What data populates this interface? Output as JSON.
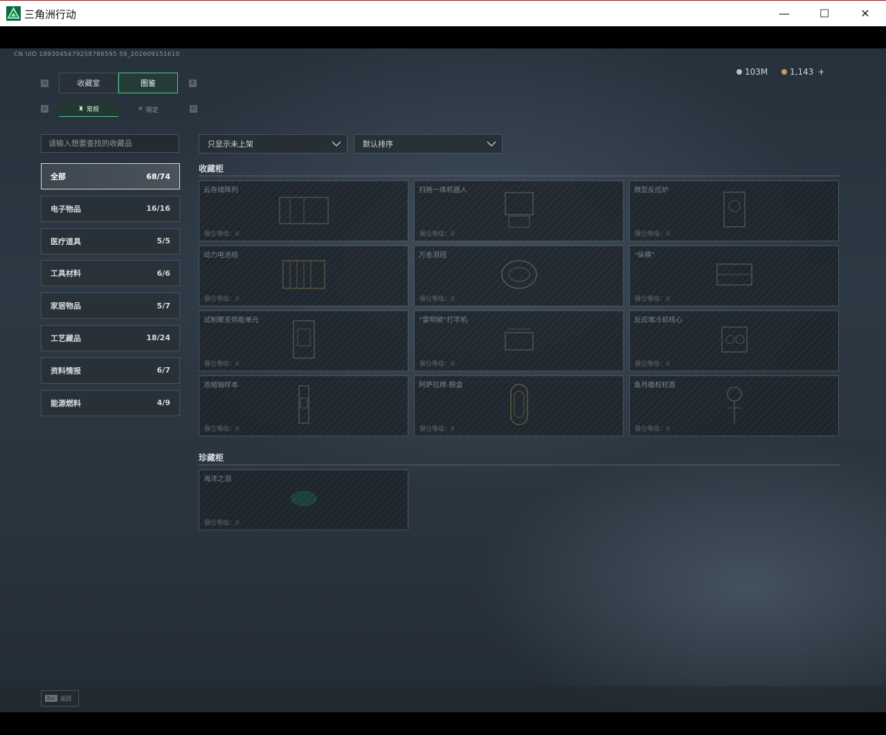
{
  "window": {
    "title": "三角洲行动",
    "min_glyph": "—",
    "max_glyph": "☐",
    "close_glyph": "✕"
  },
  "uid": "CN UID 1893045479258786595 59_202609151610",
  "currency": {
    "silver": "103M",
    "gold": "1,143",
    "add": "+"
  },
  "keys": {
    "q": "Q",
    "e": "E",
    "a": "A",
    "d": "D"
  },
  "tabs": {
    "collection_room": "收藏室",
    "catalog": "图鉴"
  },
  "subtabs": {
    "regular": "常规",
    "limited": "限定"
  },
  "search": {
    "placeholder": "请输入想要查找的收藏品"
  },
  "categories": [
    {
      "label": "全部",
      "count": "68/74"
    },
    {
      "label": "电子物品",
      "count": "16/16"
    },
    {
      "label": "医疗道具",
      "count": "5/5"
    },
    {
      "label": "工具材料",
      "count": "6/6"
    },
    {
      "label": "家居物品",
      "count": "5/7"
    },
    {
      "label": "工艺藏品",
      "count": "18/24"
    },
    {
      "label": "资料情报",
      "count": "6/7"
    },
    {
      "label": "能源燃料",
      "count": "4/9"
    }
  ],
  "filters": {
    "show": "只显示未上架",
    "sort": "默认排序"
  },
  "sections": {
    "cabinet": "收藏柜",
    "treasure": "珍藏柜"
  },
  "cabinet_items": [
    {
      "name": "云存储阵列",
      "level": "展位等级：0"
    },
    {
      "name": "扫拖一体机器人",
      "level": "展位等级：0"
    },
    {
      "name": "微型反应炉",
      "level": "展位等级：0"
    },
    {
      "name": "动力电池组",
      "level": "展位等级：0"
    },
    {
      "name": "万金泪冠",
      "level": "展位等级：0"
    },
    {
      "name": "“纵横”",
      "level": "展位等级：0"
    },
    {
      "name": "试制聚变供能单元",
      "level": "展位等级：0"
    },
    {
      "name": "“雷明顿”打字机",
      "level": "展位等级：0"
    },
    {
      "name": "反应堆冷却核心",
      "level": "展位等级：0"
    },
    {
      "name": "浓缩铀样本",
      "level": "展位等级：0"
    },
    {
      "name": "阿萨拉牌-腕盒",
      "level": "展位等级：0"
    },
    {
      "name": "鱼月徽权杖首",
      "level": "展位等级：0"
    }
  ],
  "treasure_items": [
    {
      "name": "海洋之泪",
      "level": "展位等级：0"
    }
  ],
  "footer": {
    "esc_key": "Esc",
    "back": "返回"
  }
}
